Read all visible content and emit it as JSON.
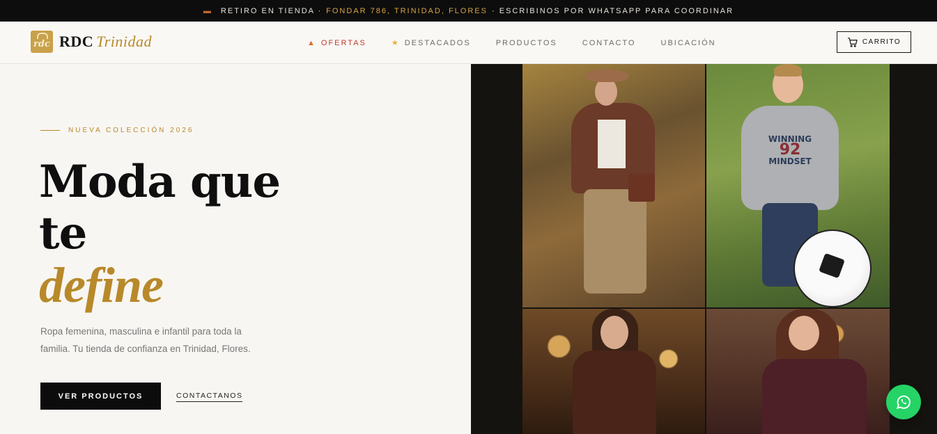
{
  "announcement": {
    "icon": "truck-icon",
    "lead": "RETIRO EN TIENDA ·",
    "address": "FONDAR 786, TRINIDAD, FLORES",
    "tail": "· ESCRIBINOS POR WHATSAPP PARA COORDINAR"
  },
  "brand": {
    "mark": "rdc",
    "name_bold": "RDC",
    "name_italic": "Trinidad"
  },
  "nav": {
    "items": [
      {
        "label": "OFERTAS",
        "icon": "flame-icon",
        "active": true
      },
      {
        "label": "DESTACADOS",
        "icon": "star-icon",
        "active": false
      },
      {
        "label": "PRODUCTOS",
        "icon": "",
        "active": false
      },
      {
        "label": "CONTACTO",
        "icon": "",
        "active": false
      },
      {
        "label": "UBICACIÓN",
        "icon": "",
        "active": false
      }
    ],
    "cart_label": "CARRITO"
  },
  "hero": {
    "eyebrow": "NUEVA COLECCIÓN 2026",
    "headline_line1": "Moda que",
    "headline_line2": "te",
    "headline_accent": "define",
    "description": "Ropa femenina, masculina e infantil para toda la familia. Tu tienda de confianza en Trinidad, Flores.",
    "primary_button": "VER PRODUCTOS",
    "secondary_link": "CONTACTANOS",
    "kid_sweatshirt_text": [
      "WINNING",
      "92",
      "MINDSET"
    ]
  },
  "colors": {
    "accent_gold": "#b8892a",
    "dark": "#0c0c0c",
    "offer_red": "#c0392b",
    "whatsapp_green": "#25d366"
  }
}
